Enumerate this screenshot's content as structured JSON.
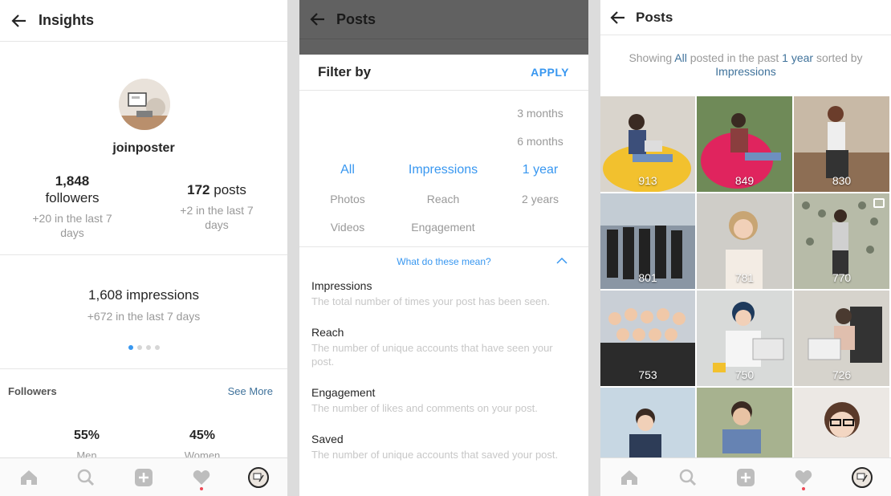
{
  "insights": {
    "title": "Insights",
    "username": "joinposter",
    "followers": {
      "num": "1,848",
      "label": "followers",
      "sub": "+20 in the last 7 days"
    },
    "posts": {
      "num": "172",
      "label": "posts",
      "sub": "+2 in the last 7 days"
    },
    "impressions": {
      "main": "1,608 impressions",
      "sub": "+672 in the last 7 days"
    },
    "carousel": {
      "active_index": 1,
      "count": 4
    },
    "followers_section": {
      "label": "Followers",
      "see_more": "See More"
    },
    "gender": [
      {
        "pct": "55%",
        "label": "Men"
      },
      {
        "pct": "45%",
        "label": "Women"
      }
    ]
  },
  "filter": {
    "title": "Posts",
    "filter_by": "Filter by",
    "apply": "APPLY",
    "options": {
      "durations_extra": [
        "3 months",
        "6 months"
      ],
      "col1": [
        "All",
        "Photos",
        "Videos"
      ],
      "col2": [
        "Impressions",
        "Reach",
        "Engagement"
      ],
      "col3": [
        "1 year",
        "2 years"
      ]
    },
    "what": "What do these mean?",
    "definitions": [
      {
        "term": "Impressions",
        "desc": "The total number of times your post has been seen."
      },
      {
        "term": "Reach",
        "desc": "The number of unique accounts that have seen your post."
      },
      {
        "term": "Engagement",
        "desc": "The number of likes and comments on your post."
      },
      {
        "term": "Saved",
        "desc": "The number of unique accounts that saved your post."
      }
    ]
  },
  "grid": {
    "title": "Posts",
    "summary": {
      "p1": "Showing ",
      "all": "All",
      "p2": " posted in the past ",
      "year": "1 year",
      "p3": " sorted by",
      "sort": "Impressions"
    },
    "posts": [
      {
        "count": "913",
        "bg": "#d9d4cc"
      },
      {
        "count": "849",
        "bg": "#6f8a58"
      },
      {
        "count": "830",
        "bg": "#c8b9a6"
      },
      {
        "count": "801",
        "bg": "#8a96a4"
      },
      {
        "count": "781",
        "bg": "#cfcdc8"
      },
      {
        "count": "770",
        "bg": "#9da38e"
      },
      {
        "count": "753",
        "bg": "#c9cfd6"
      },
      {
        "count": "750",
        "bg": "#d8dad9"
      },
      {
        "count": "726",
        "bg": "#d6d3cc"
      },
      {
        "count": "",
        "bg": "#c7d7e3"
      },
      {
        "count": "",
        "bg": "#a7b28f"
      },
      {
        "count": "",
        "bg": "#ece8e4"
      }
    ]
  },
  "colors": {
    "accent": "#3897f0",
    "link": "#3f729b",
    "notify": "#ed4956"
  }
}
